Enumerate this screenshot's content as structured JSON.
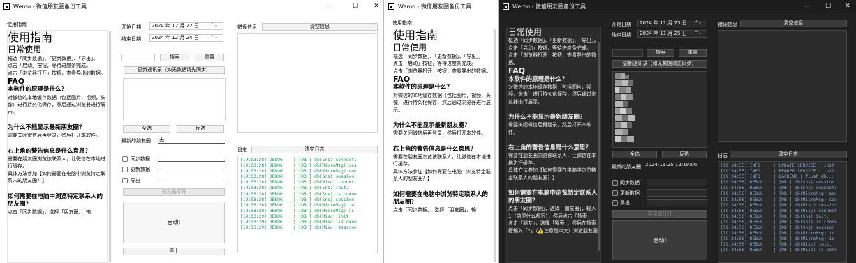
{
  "w1": {
    "title": "Wemo - 微信朋友圈备份工具",
    "ctrl": {
      "min": "—",
      "max": "☐",
      "close": "✕"
    },
    "guide_label": "使用指南",
    "date_start_label": "开始日期",
    "date_start": "2024 年 12 月 22 日",
    "date_end_label": "结束日期",
    "date_end": "2024 年 12 月 24 日",
    "search_btn": "搜索",
    "reset_btn": "重置",
    "update_contacts_btn": "更新通讯录（如无数据请先同步）",
    "select_all": "全选",
    "invert": "反选",
    "latest_label": "最新的朋友圈",
    "latest_value": "无",
    "cb_sync": "同步数据",
    "cb_update": "更新数据",
    "cb_export": "导出",
    "browser_btn": "浏览器打开",
    "start_btn": "启动!",
    "stop_btn": "停止",
    "error_label": "错误信息",
    "clear_error": "清空信息",
    "log_label": "日志",
    "clear_log": "清空日志",
    "logs": [
      "[19:03:28] DEBUG    | [DB ] db(Sns) connecti",
      "[19:03:28] DEBUG    | [DB ] db(MicroMsg) ses",
      "[19:03:28] DEBUG    | [DB ] db(MicroMsg) con",
      "[19:03:28] DEBUG    | [DB ] db(Sns) session",
      "[19:03:28] DEBUG    | [DB ] db(Misc) connect",
      "[19:03:28] DEBUG    | [DB ] db(Sns) init.",
      "[19:03:28] DEBUG    | [DB ] db(Sns) is conne",
      "[19:03:28] DEBUG    | [DB ] db(Sns) session",
      "[19:03:28] DEBUG    | [DB ] db(MicroMsg) in",
      "[19:03:28] DEBUG    | [DB ] db(MicroMsg) is",
      "[19:03:29] DEBUG    | [DB ] db(Misc) init.",
      "[19:03:29] DEBUG    | [DB ] db(Misc) is conn",
      "[19:03:29] DEBUG    | [DB ] db(Misc) session"
    ]
  },
  "w2": {
    "title": "Wemo - 微信朋友圈备份工具",
    "guide_label": "使用指南"
  },
  "w3": {
    "title": "Wemo - 微信朋友圈备份工具",
    "ctrl": {
      "min": "—",
      "max": "☐",
      "close": "✕"
    },
    "date_start_label": "开始日期",
    "date_start": "2024 年 11 月 23 日",
    "date_end_label": "结束日期",
    "date_end": "2024 年 11 月 25 日",
    "search_btn": "搜索",
    "reset_btn": "重置",
    "update_contacts_btn": "更新通讯录（如无数据请先同步）",
    "select_all": "全选",
    "invert": "反选",
    "latest_label": "最新的朋友圈",
    "latest_value": "2024-11-25 12:19:06",
    "cb_sync": "同步数据",
    "cb_update": "更新数据",
    "cb_export": "导出",
    "browser_btn": "浏览器打开",
    "start_btn": "启动!",
    "error_label": "错误信息",
    "clear_error": "清空信息",
    "log_label": "日志",
    "clear_log": "清空日志",
    "logs": [
      "[19:34:55] INFO     | UPDATE SERVICE | init",
      "[19:34:55] INFO     | RENDER SERVICE | init",
      "[19:34:55] INFO     | BACKEND | flush db...",
      "[19:34:56] DEBUG    | [DB ] db(Sns) session",
      "[19:34:56] DEBUG    | [DB ] db(Sns) connecti",
      "[19:34:56] DEBUG    | [DB ] db(MicroMsg) ses",
      "[19:34:56] DEBUG    | [DB ] db(MicroMsg) con",
      "[19:34:56] DEBUG    | [DB ] db(Misc) session",
      "[19:34:56] DEBUG    | [DB ] db(Misc) connect",
      "[19:34:56] DEBUG    | [DB ] db(Sns) init.",
      "[19:34:56] DEBUG    | [DB ] db(Sns) is conne",
      "[19:34:56] DEBUG    | [DB ] db(Sns) session",
      "[19:34:56] DEBUG    | [DB ] db(MicroMsg) in",
      "[19:34:56] DEBUG    | [DB ] db(MicroMsg) is",
      "[19:34:56] DEBUG    | [DB ] db(Misc) init.",
      "[19:34:56] DEBUG    | [DB ] db(Misc) is conn"
    ]
  },
  "guide": {
    "title": "使用指南",
    "daily": "日常使用",
    "p1": "框选「同步数据」、「更新数据」、「导出」。",
    "p2": "点击「启动」按钮，等待进度条完成。",
    "p3": "点击「浏览器打开」按钮，查看导出的数据。",
    "faq": "FAQ",
    "q1": "本软件的原理是什么？",
    "a1": "对微信的本地缓存数据（包括图片，视频，头像）进行持久化保存，然后通过浏览器进行展示。",
    "q2": "为什么不能显示最新朋友圈？",
    "a2": "需要关闭微信后再登录，然后打开本软件。",
    "q3": "右上角的警告信息是什么意思？",
    "a3": "需要在朋友圈浏览该联系人，让微信在本地进行缓存。",
    "a3b": "具体方法参加【如何需要在电脑中浏览特定联系人的朋友圈？】",
    "q4": "如何需要在电脑中浏览特定联系人的朋友圈？",
    "a4": "点击「同步数据」，选择「朋友圈」，输入 1（随便什么都行），然后点击「搜索」",
    "a4b": "点击「朋友」，选择「搜索」，然后在搜索框输入「?」（⚠️注意是中文）浏览朋友圈",
    "a4_partial": "点击「同步数据」，选择「朋友圈」，输"
  },
  "colors": {
    "accent": "#1f9d55",
    "dark_bg": "#202020",
    "log_light": "#1a9a5a",
    "log_dark": "#7fa6d6"
  }
}
